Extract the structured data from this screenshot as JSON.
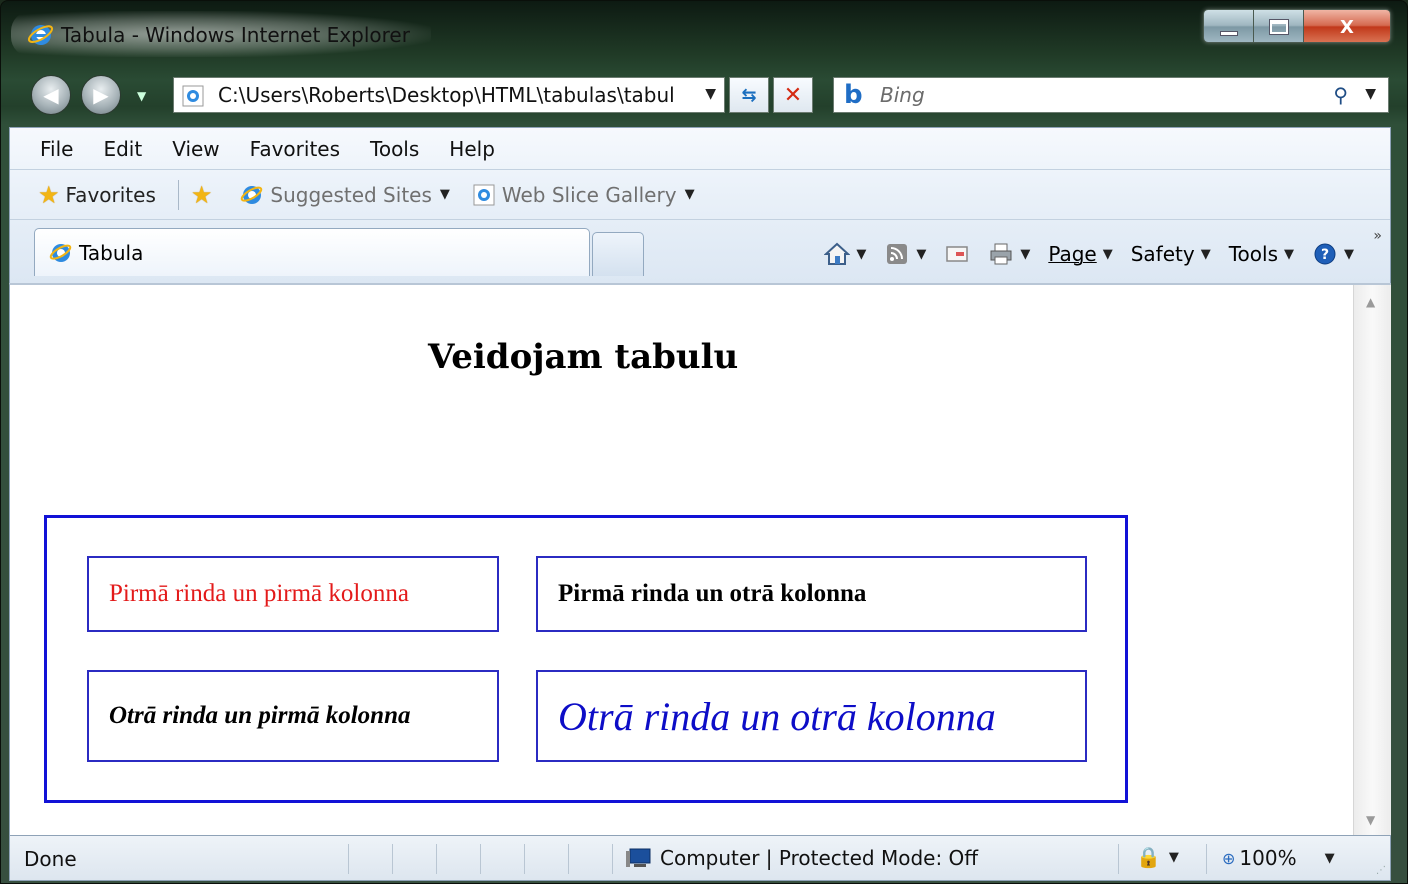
{
  "window": {
    "title": "Tabula - Windows Internet Explorer",
    "minimize_icon": "minimize-icon",
    "maximize_icon": "maximize-icon",
    "close_glyph": "X"
  },
  "address_bar": {
    "url": "C:\\Users\\Roberts\\Desktop\\HTML\\tabulas\\tabul",
    "refresh_icon": "refresh-icon",
    "stop_icon": "stop-icon"
  },
  "search": {
    "placeholder": "Bing"
  },
  "menu": {
    "items": [
      "File",
      "Edit",
      "View",
      "Favorites",
      "Tools",
      "Help"
    ]
  },
  "favorites_bar": {
    "favorites_label": "Favorites",
    "suggested_sites": "Suggested Sites",
    "web_slice_gallery": "Web Slice Gallery"
  },
  "tabs": {
    "active_label": "Tabula"
  },
  "command_bar": {
    "page": "Page",
    "safety": "Safety",
    "tools": "Tools"
  },
  "page": {
    "heading": "Veidojam tabulu",
    "table": {
      "r1c1": "Pirmā rinda un pirmā kolonna",
      "r1c2": "Pirmā rinda un otrā kolonna",
      "r2c1": "Otrā rinda un pirmā kolonna",
      "r2c2": "Otrā rinda un otrā kolonna"
    },
    "colors": {
      "r1c1_text": "#e31a1a",
      "r2c2_text": "#0d0dc7",
      "table_border": "#1212d6"
    }
  },
  "status_bar": {
    "status": "Done",
    "zone": "Computer | Protected Mode: Off",
    "zoom": "100%"
  }
}
